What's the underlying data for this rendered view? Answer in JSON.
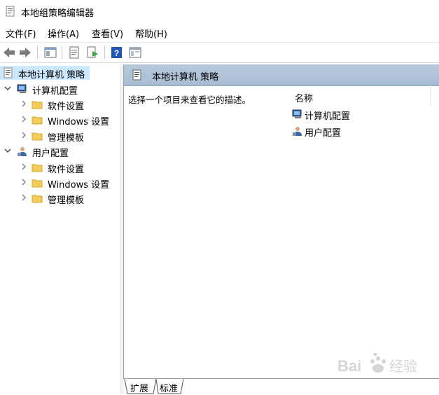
{
  "window": {
    "title": "本地组策略编辑器",
    "app_icon": "policy-editor-icon"
  },
  "menu": [
    {
      "label": "文件(F)"
    },
    {
      "label": "操作(A)"
    },
    {
      "label": "查看(V)"
    },
    {
      "label": "帮助(H)"
    }
  ],
  "toolbar": {
    "icons": [
      "back-arrow-icon",
      "forward-arrow-icon",
      "show-hide-tree-icon",
      "properties-icon",
      "export-list-icon",
      "help-icon",
      "extended-view-icon"
    ]
  },
  "tree": {
    "root": {
      "label": "本地计算机 策略"
    },
    "computer": {
      "label": "计算机配置",
      "children": [
        {
          "label": "软件设置"
        },
        {
          "label": "Windows 设置"
        },
        {
          "label": "管理模板"
        }
      ]
    },
    "user": {
      "label": "用户配置",
      "children": [
        {
          "label": "软件设置"
        },
        {
          "label": "Windows 设置"
        },
        {
          "label": "管理模板"
        }
      ]
    }
  },
  "details": {
    "header": "本地计算机 策略",
    "description": "选择一个项目来查看它的描述。",
    "column_name": "名称",
    "items": [
      {
        "label": "计算机配置"
      },
      {
        "label": "用户配置"
      }
    ]
  },
  "tabs": [
    {
      "label": "扩展"
    },
    {
      "label": "标准"
    }
  ],
  "watermark": {
    "text": "Bai 经验"
  },
  "colors": {
    "selection": "#cce8ff",
    "header_bar": "#b0c3d8",
    "folder": "#f3cc5a",
    "help_blue": "#2156b5"
  }
}
